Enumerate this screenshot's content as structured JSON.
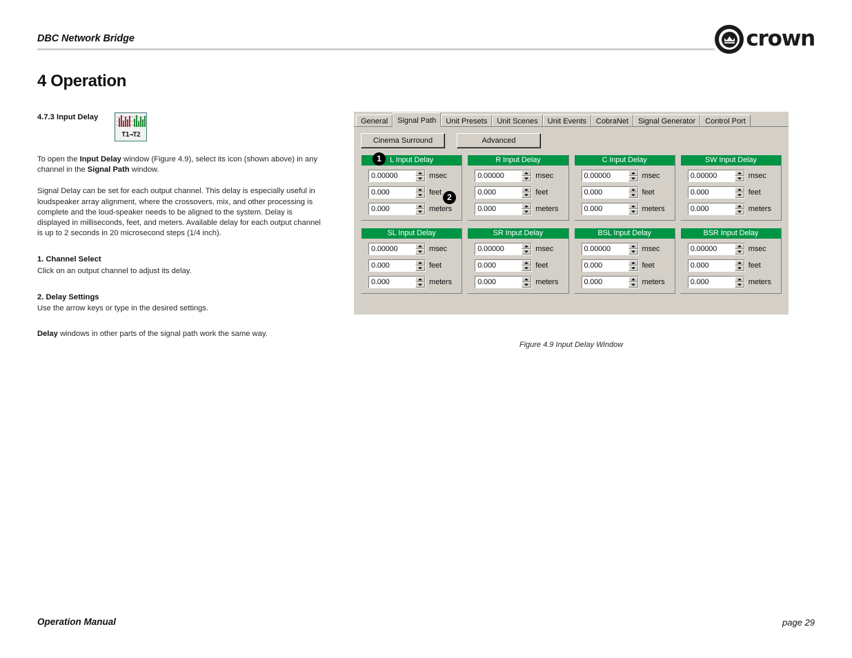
{
  "header": {
    "title": "DBC Network Bridge",
    "logo_wordmark": "crown"
  },
  "chapter": {
    "title": "4 Operation"
  },
  "section": {
    "number_and_title": "4.7.3 Input Delay",
    "icon_label": "T1→T2",
    "paragraph_open_a": "To open the ",
    "paragraph_open_b": "Input Delay",
    "paragraph_open_c": " window (Figure 4.9), select its icon (shown above) in any channel in the ",
    "paragraph_open_d": "Signal Path",
    "paragraph_open_e": " window.",
    "paragraph_description": "Signal Delay can be set for each output channel. This delay is especially useful in loudspeaker array alignment, where the crossovers, mix, and other processing is complete and the loud-speaker needs to be aligned to the system. Delay is displayed in milliseconds, feet, and meters. Available delay for each output channel is up to 2 seconds in 20 microsecond steps (1/4 inch).",
    "item1_head": "1. Channel Select",
    "item1_body": "Click on an output channel to adjust its delay.",
    "item2_head": "2. Delay Settings",
    "item2_body": "Use the arrow keys or type in the desired settings.",
    "closing_a": "Delay",
    "closing_b": " windows in other parts of the signal path work the same way."
  },
  "dialog": {
    "tabs": [
      {
        "label": "General",
        "active": false
      },
      {
        "label": "Signal Path",
        "active": true
      },
      {
        "label": "Unit Presets",
        "active": false
      },
      {
        "label": "Unit Scenes",
        "active": false
      },
      {
        "label": "Unit Events",
        "active": false
      },
      {
        "label": "CobraNet",
        "active": false
      },
      {
        "label": "Signal Generator",
        "active": false
      },
      {
        "label": "Control Port",
        "active": false
      }
    ],
    "buttons": [
      {
        "label": "Cinema Surround"
      },
      {
        "label": "Advanced"
      }
    ],
    "callouts": [
      {
        "number": "1"
      },
      {
        "number": "2"
      }
    ],
    "field_rows": [
      {
        "value": "0.00000",
        "unit": "msec"
      },
      {
        "value": "0.000",
        "unit": "feet"
      },
      {
        "value": "0.000",
        "unit": "meters"
      }
    ],
    "channels": [
      {
        "title": "L Input Delay"
      },
      {
        "title": "R Input Delay"
      },
      {
        "title": "C Input Delay"
      },
      {
        "title": "SW Input Delay"
      },
      {
        "title": "SL Input Delay"
      },
      {
        "title": "SR Input Delay"
      },
      {
        "title": "BSL Input Delay"
      },
      {
        "title": "BSR Input Delay"
      }
    ],
    "accent_green": "#009445",
    "chrome_gray": "#d4d0c8"
  },
  "figure": {
    "caption": "Figure 4.9  Input Delay Window"
  },
  "footer": {
    "left": "Operation Manual",
    "right": "page 29"
  }
}
